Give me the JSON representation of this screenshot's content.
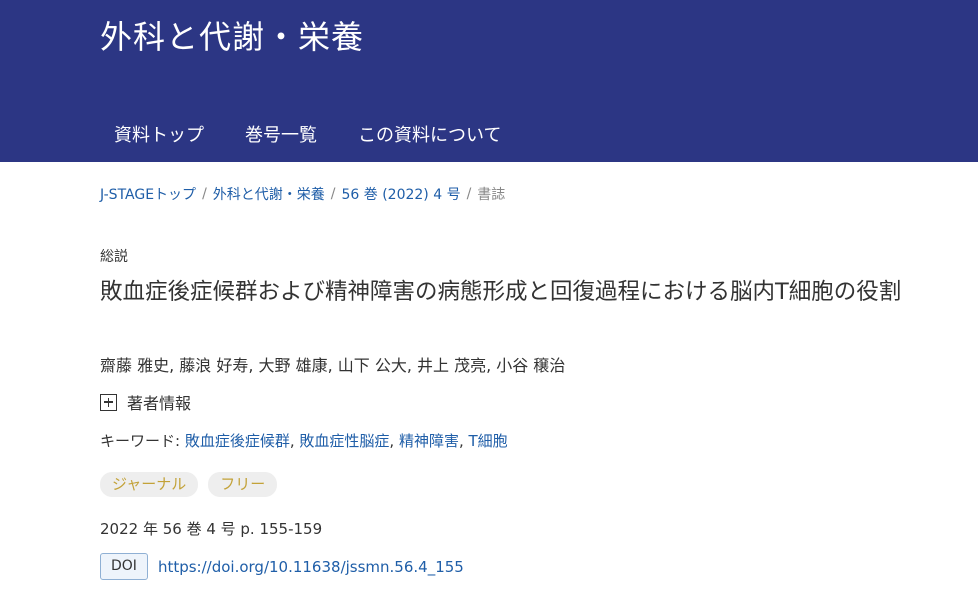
{
  "header": {
    "journal_title": "外科と代謝・栄養",
    "nav": [
      "資料トップ",
      "巻号一覧",
      "この資料について"
    ]
  },
  "breadcrumb": {
    "items": [
      "J-STAGEトップ",
      "外科と代謝・栄養",
      "56 巻 (2022) 4 号"
    ],
    "separator": "/",
    "current": "書誌"
  },
  "article": {
    "type": "総説",
    "title": "敗血症後症候群および精神障害の病態形成と回復過程における脳内T細胞の役割",
    "authors": "齋藤 雅史, 藤浪 好寿, 大野 雄康, 山下 公大, 井上 茂亮, 小谷 穣治",
    "author_info_label": "著者情報",
    "keywords_label": "キーワード: ",
    "keywords": [
      "敗血症後症候群",
      "敗血症性脳症",
      "精神障害",
      "T細胞"
    ],
    "keyword_separator": ", ",
    "badges": [
      "ジャーナル",
      "フリー"
    ],
    "pubinfo": "2022 年 56 巻 4 号 p. 155-159",
    "doi_label": "DOI",
    "doi_url": "https://doi.org/10.11638/jssmn.56.4_155"
  },
  "colors": {
    "header_bg": "#2c3684",
    "link": "#1f5ea8",
    "badge_text": "#c3a238"
  }
}
